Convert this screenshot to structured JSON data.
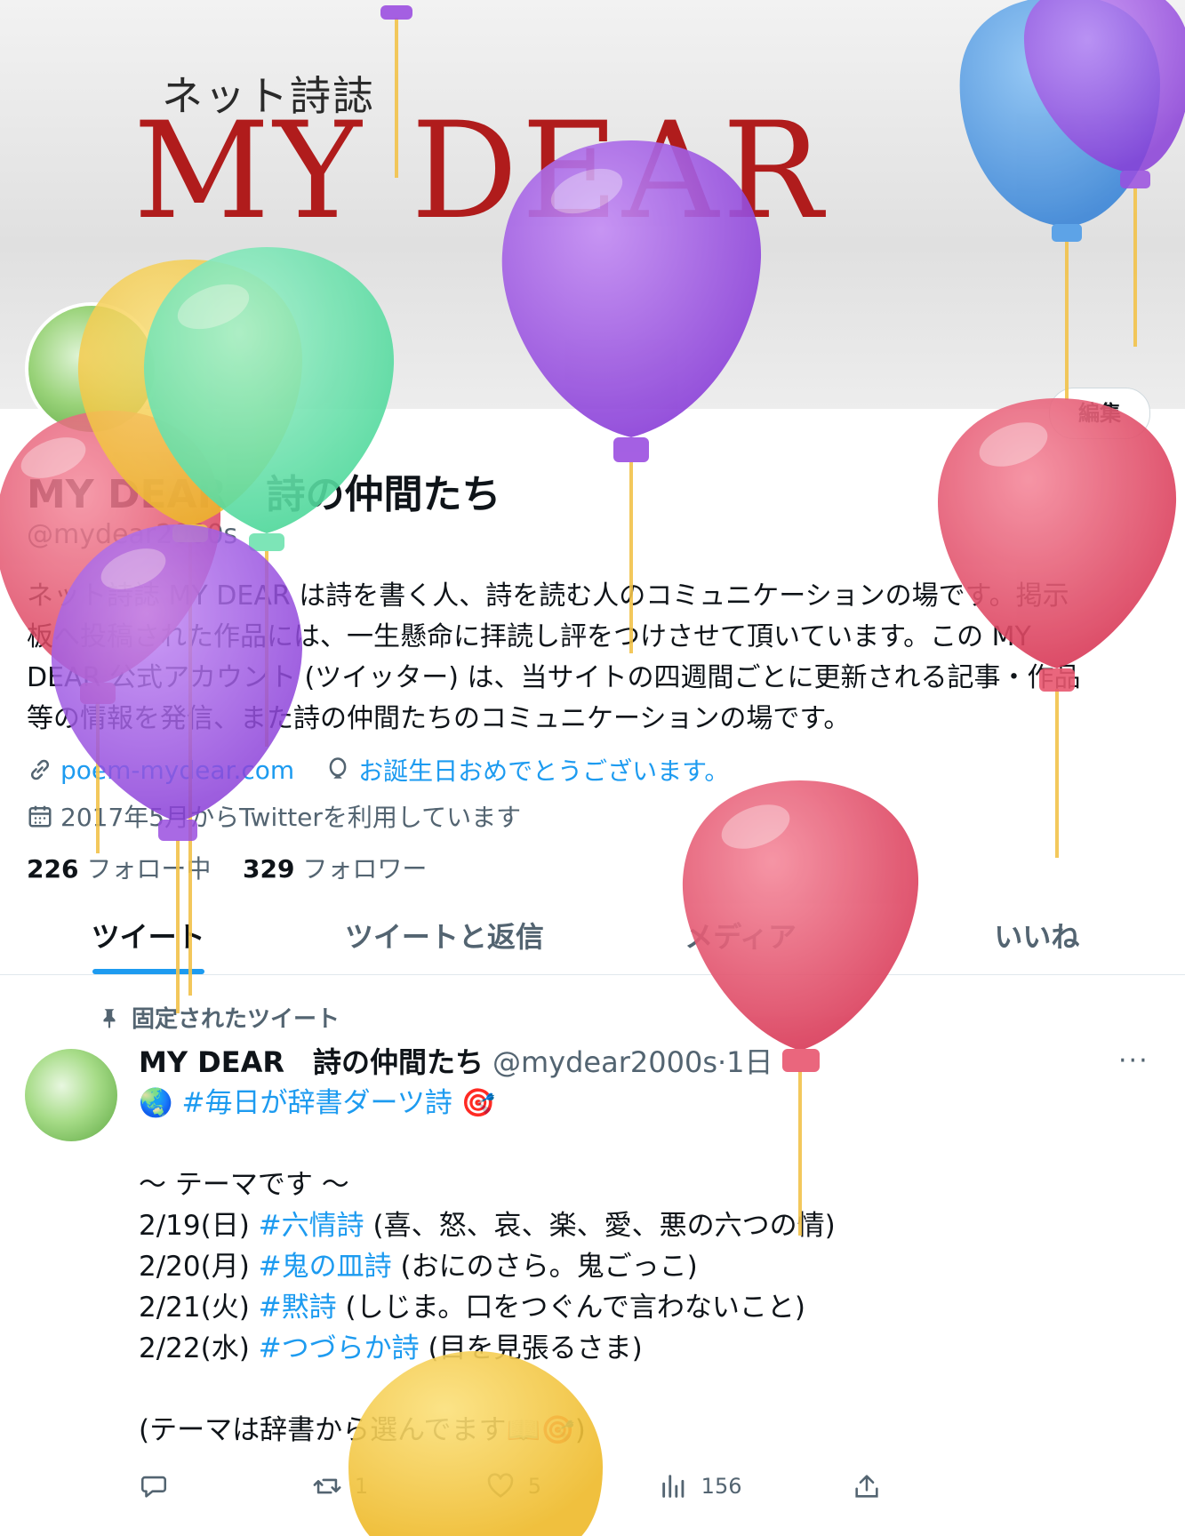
{
  "banner": {
    "subtitle": "ネット詩誌",
    "title": "MY DEAR"
  },
  "profile": {
    "edit_label": "編集",
    "display_name": "MY DEAR　詩の仲間たち",
    "handle": "@mydear2000s",
    "bio_lines": [
      "ネット詩誌 MY DEAR は詩を書く人、詩を読む人のコミュニケーションの場です。掲示",
      "板へ投稿された作品には、一生懸命に拝読し評をつけさせて頂いています。この MY",
      "DEAR 公式アカウント (ツイッター) は、当サイトの四週間ごとに更新される記事・作品",
      "等の情報を発信、また詩の仲間たちのコミュニケーションの場です。"
    ],
    "website": "poem-mydear.com",
    "birthday_text": "お誕生日おめでとうございます。",
    "joined": "2017年5月からTwitterを利用しています",
    "following_count": "226",
    "following_label": "フォロー中",
    "followers_count": "329",
    "followers_label": "フォロワー",
    "link_color": "#1d9bf0"
  },
  "tabs": [
    {
      "label": "ツイート",
      "active": true
    },
    {
      "label": "ツイートと返信",
      "active": false
    },
    {
      "label": "メディア",
      "active": false
    },
    {
      "label": "いいね",
      "active": false
    }
  ],
  "pinned_tweet": {
    "pinned_label": "固定されたツイート",
    "author_name": "MY DEAR　詩の仲間たち",
    "author_handle": "@mydear2000s",
    "separator": "·",
    "time": "1日",
    "more_label": "···",
    "hashtag_line": {
      "prefix_emoji": "🌏",
      "hashtag": "#毎日が辞書ダーツ詩",
      "suffix_emoji": "🎯"
    },
    "theme_heading": "～ テーマです ～",
    "themes": [
      {
        "date": "2/19(日)",
        "tag": "#六情詩",
        "desc": "(喜、怒、哀、楽、愛、悪の六つの情)"
      },
      {
        "date": "2/20(月)",
        "tag": "#鬼の皿詩",
        "desc": "(おにのさら。鬼ごっこ)"
      },
      {
        "date": "2/21(火)",
        "tag": "#黙詩",
        "desc": "(しじま。口をつぐんで言わないこと)"
      },
      {
        "date": "2/22(水)",
        "tag": "#つづらか詩",
        "desc": "(目を見張るさま)"
      }
    ],
    "footer_note": "(テーマは辞書から選んでます📖🎯)",
    "stats": {
      "replies": "",
      "retweets": "1",
      "likes": "5",
      "views": "156"
    }
  },
  "balloons": {
    "colors": [
      "#9b4fe0",
      "#e8566f",
      "#f2cc4b",
      "#6fe3b0",
      "#4f9de8"
    ]
  }
}
